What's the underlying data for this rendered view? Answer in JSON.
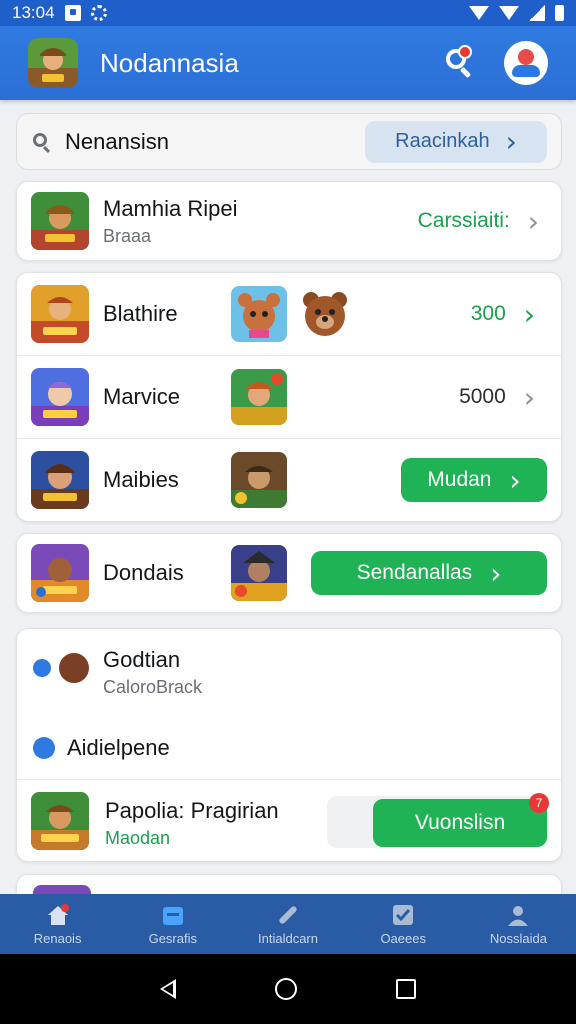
{
  "status": {
    "time": "13:04"
  },
  "appbar": {
    "title": "Nodannasia"
  },
  "search": {
    "value": "Nenansisn",
    "action_label": "Raacinkah"
  },
  "list1": {
    "title": "Mamhia Ripei",
    "subtitle": "Braaa",
    "action": "Carssiaiti:"
  },
  "list2": [
    {
      "title": "Blathire",
      "value": "300"
    },
    {
      "title": "Marvice",
      "value": "5000"
    },
    {
      "title": "Maibies",
      "button": "Mudan"
    }
  ],
  "list3": {
    "title": "Dondais",
    "button": "Sendanallas"
  },
  "section": {
    "group_title": "Godtian",
    "group_subtitle": "CaloroBrack",
    "sub_heading": "Aidielpene",
    "item_title": "Papolia: Pragirian",
    "item_sub": "Maodan",
    "item_button": "Vuonslisn",
    "badge": "7"
  },
  "bottom_nav": [
    {
      "label": "Renaois"
    },
    {
      "label": "Gesrafis"
    },
    {
      "label": "Intialdcarn"
    },
    {
      "label": "Oaeees"
    },
    {
      "label": "Nosslaida"
    }
  ],
  "colors": {
    "primary": "#2b6fd6",
    "green": "#1fb356",
    "nav": "#2a5ca6"
  }
}
